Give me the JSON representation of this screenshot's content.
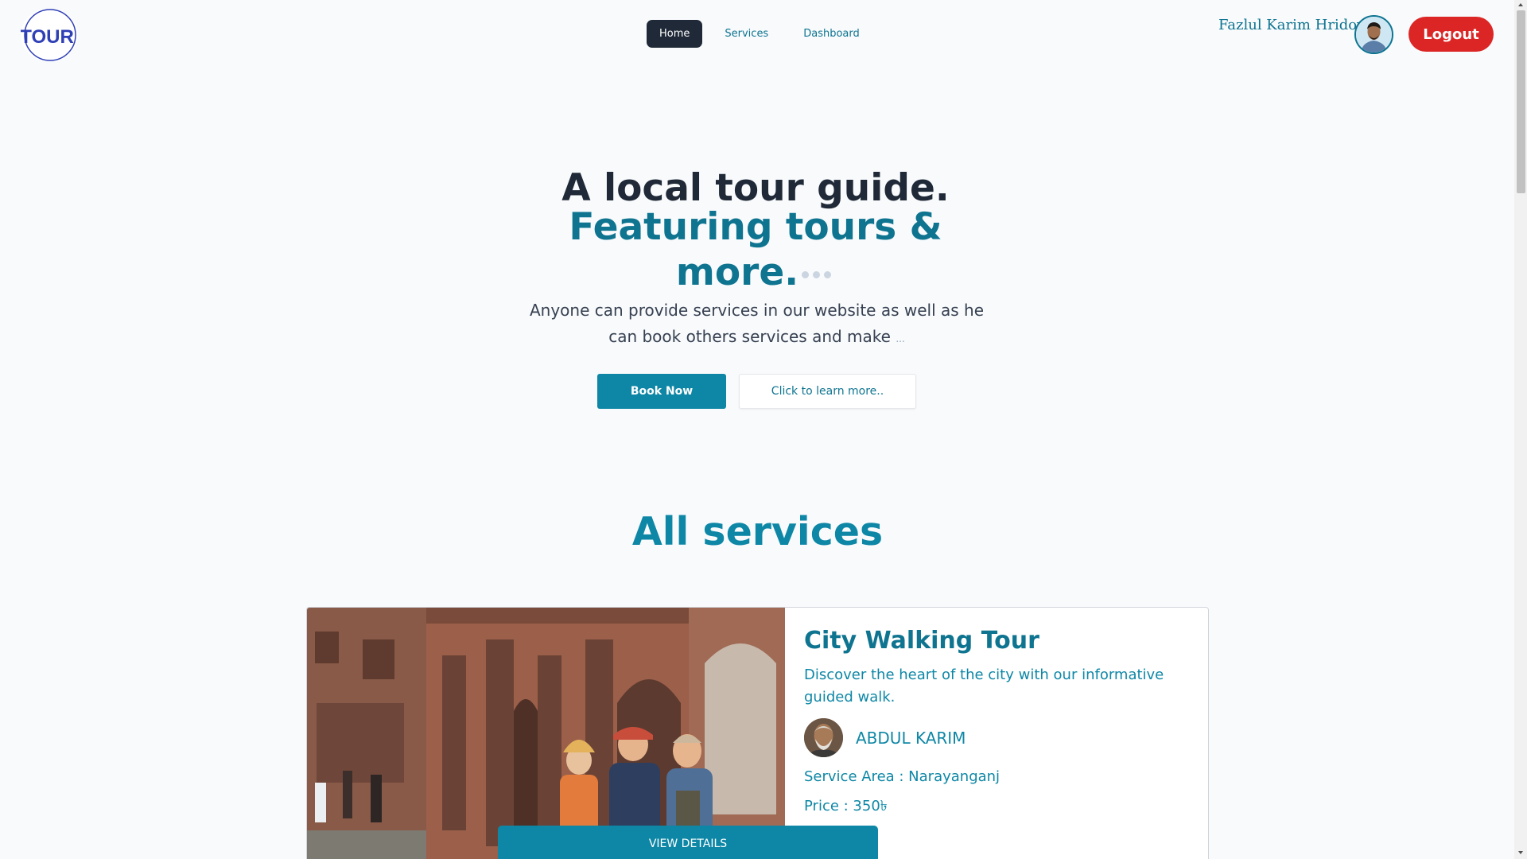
{
  "brand": {
    "logo_text": "TOUR"
  },
  "nav": {
    "items": [
      {
        "label": "Home",
        "active": true
      },
      {
        "label": "Services",
        "active": false
      },
      {
        "label": "Dashboard",
        "active": false
      }
    ],
    "user_name": "Fazlul Karim Hridoy",
    "logout_label": "Logout"
  },
  "hero": {
    "title_line1": "A local tour guide.",
    "title_line2": "Featuring tours & more.",
    "subtitle": "Anyone can provide services in our website as well as he can book others services and make",
    "subtitle_ellipsis": "...",
    "book_label": "Book Now",
    "learn_label": "Click to learn more.."
  },
  "services": {
    "heading": "All services",
    "cards": [
      {
        "title": "City Walking Tour",
        "description": "Discover the heart of the city with our informative guided walk.",
        "guide_name": "ABDUL KARIM",
        "area_label": "Service Area : Narayanganj",
        "price_label": "Price : 350৳",
        "button_label": "VIEW DETAILS"
      }
    ]
  },
  "colors": {
    "accent": "#0e87a6",
    "dark": "#1f2937",
    "danger": "#dc2626",
    "background": "#f8fafc"
  }
}
